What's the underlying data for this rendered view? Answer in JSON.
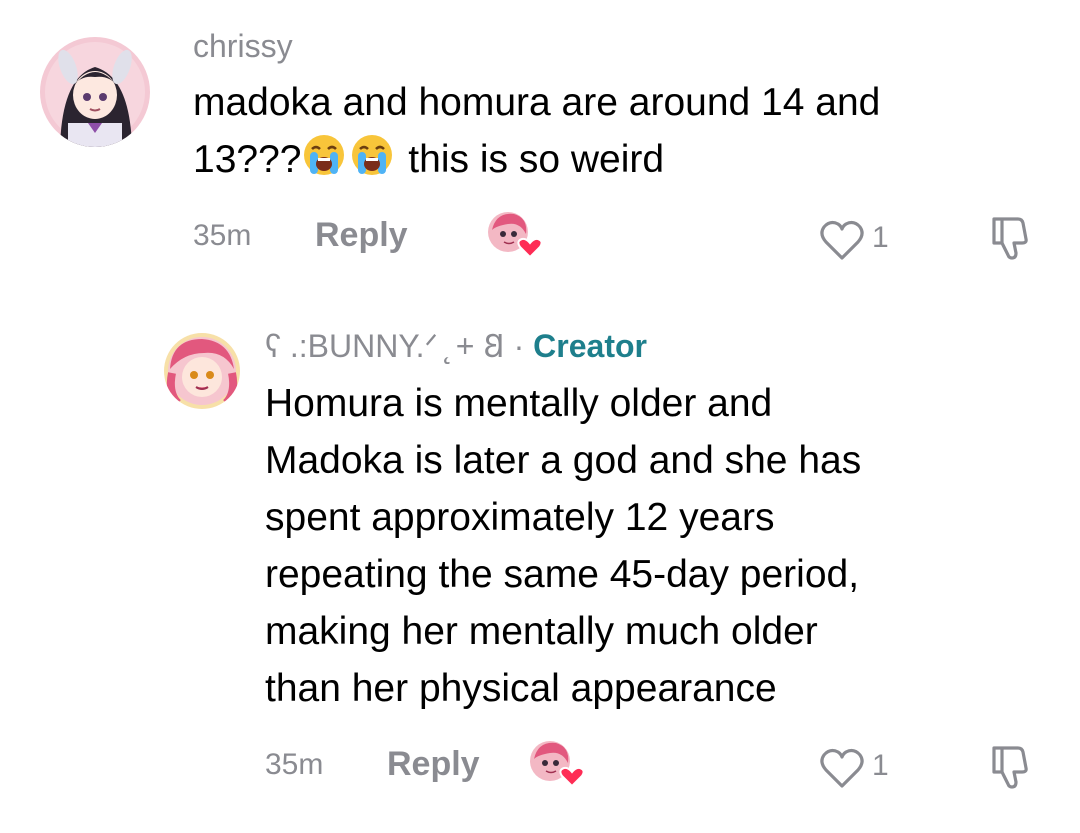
{
  "comments": [
    {
      "username": "chrissy",
      "text_line1": "madoka and homura are around 14 and",
      "text_line2_prefix": "13???",
      "emoji": "loudly-crying-face",
      "text_line2_suffix": " this is so weird",
      "time": "35m",
      "reply_label": "Reply",
      "like_count": "1"
    },
    {
      "username": "ʕ .:BUNNY.ᐟ ̨ + 𐐒",
      "separator": " · ",
      "creator_badge": "Creator",
      "lines": [
        "Homura is mentally older and",
        "Madoka is later a god and she has",
        "spent approximately 12 years",
        "repeating the same 45-day period,",
        "making her mentally much older",
        "than her physical appearance"
      ],
      "time": "35m",
      "reply_label": "Reply",
      "like_count": "1"
    }
  ],
  "colors": {
    "muted": "#8a8b91",
    "creator": "#1e7f8c",
    "heart": "#fe2c55"
  }
}
